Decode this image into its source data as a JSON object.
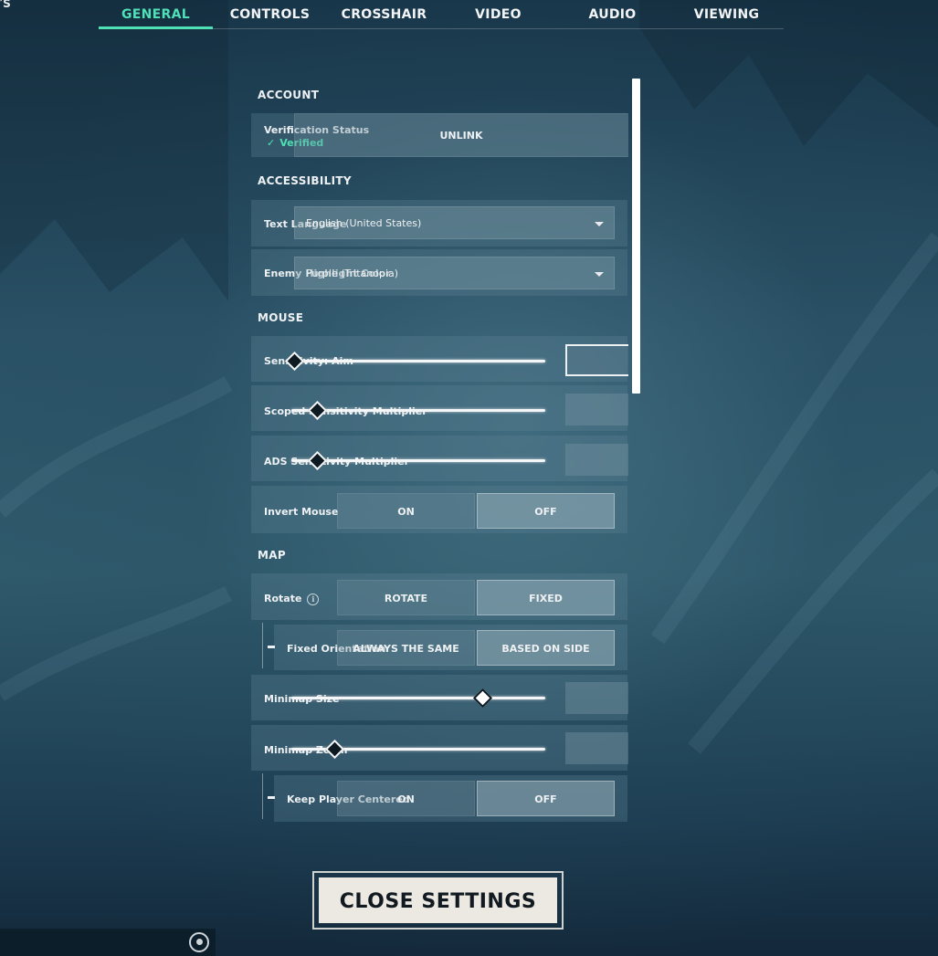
{
  "tabs": [
    {
      "label": "GENERAL",
      "active": true
    },
    {
      "label": "CONTROLS",
      "active": false
    },
    {
      "label": "CROSSHAIR",
      "active": false
    },
    {
      "label": "VIDEO",
      "active": false
    },
    {
      "label": "AUDIO",
      "active": false
    },
    {
      "label": "VIEWING",
      "active": false
    }
  ],
  "corner_glyph": "′S",
  "account": {
    "title": "ACCOUNT",
    "verification_label": "Verification Status",
    "verified_text": "Verified",
    "unlink_label": "UNLINK"
  },
  "accessibility": {
    "title": "ACCESSIBILITY",
    "text_language_label": "Text Language",
    "text_language_value": "English (United States)",
    "enemy_highlight_label": "Enemy Highlight Color",
    "enemy_highlight_value": "Purple (Tritanopia)"
  },
  "mouse": {
    "title": "MOUSE",
    "sensitivity_aim_label": "Sensitivity: Aim",
    "sensitivity_aim_level": 0.01,
    "scoped_label": "Scoped Sensitivity Multiplier",
    "scoped_level": 0.1,
    "ads_label": "ADS Sensitivity Multiplier",
    "ads_level": 0.1,
    "invert_label": "Invert Mouse",
    "invert_on": "ON",
    "invert_off": "OFF",
    "invert_selected": "OFF"
  },
  "map": {
    "title": "MAP",
    "rotate_label": "Rotate",
    "rotate_option": "ROTATE",
    "fixed_option": "FIXED",
    "rotate_selected": "FIXED",
    "fixed_orientation_label": "Fixed Orientation",
    "always_same_option": "ALWAYS THE SAME",
    "based_on_side_option": "BASED ON SIDE",
    "orientation_selected": "BASED ON SIDE",
    "minimap_size_label": "Minimap Size",
    "minimap_size_level": 0.75,
    "minimap_zoom_label": "Minimap Zoom",
    "minimap_zoom_level": 0.17,
    "keep_centered_label": "Keep Player Centered",
    "keep_on": "ON",
    "keep_off": "OFF",
    "keep_selected": "OFF"
  },
  "close_label": "CLOSE SETTINGS",
  "colors": {
    "accent": "#4fe0b6",
    "close_bg": "#ece8e2"
  },
  "icons": {
    "verified": "check-icon",
    "info": "info-icon",
    "caret": "caret-down-icon",
    "bottom": "radar-icon"
  }
}
